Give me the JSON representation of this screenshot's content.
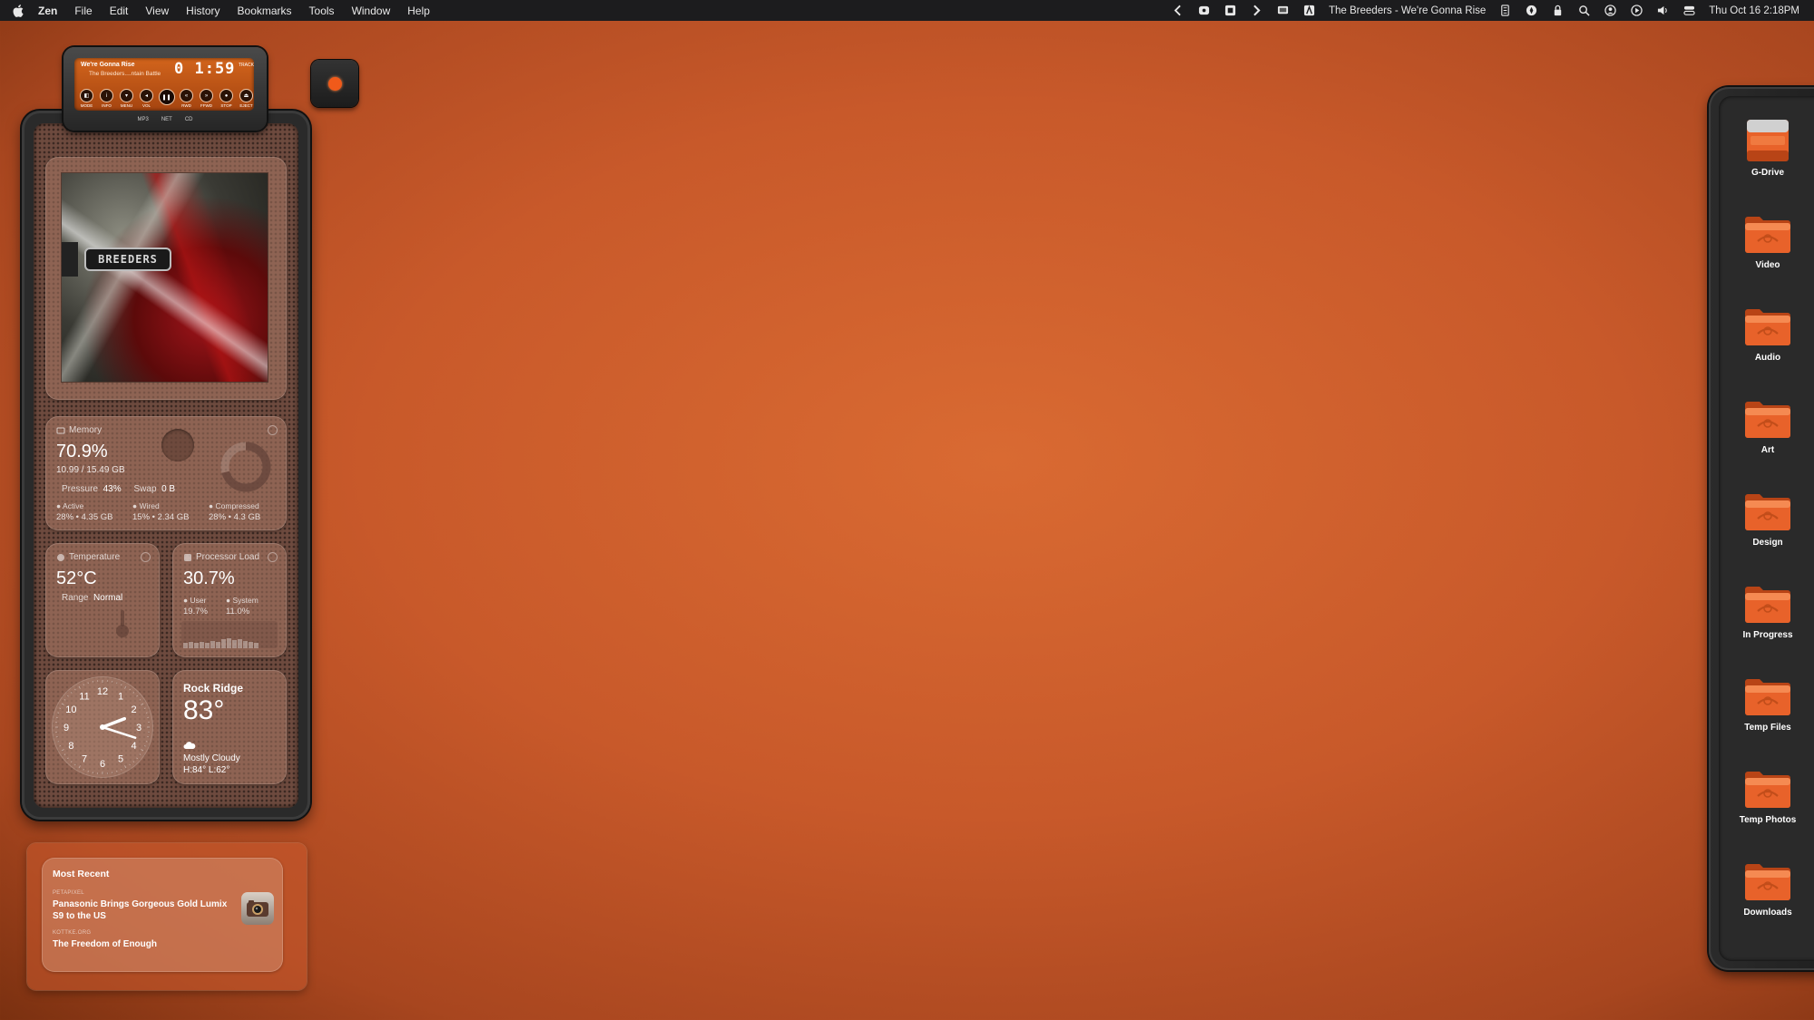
{
  "menubar": {
    "app_name": "Zen",
    "menus": [
      "File",
      "Edit",
      "View",
      "History",
      "Bookmarks",
      "Tools",
      "Window",
      "Help"
    ],
    "now_playing": "The Breeders - We're Gonna Rise",
    "datetime": "Thu Oct 16  2:18PM"
  },
  "player": {
    "track_title": "We're Gonna Rise",
    "track_artist": "The Breeders....ntain Battle",
    "time": "0 1:59",
    "track_label": "TRACK",
    "buttons": [
      "MODE",
      "INFO",
      "MENU",
      "VOL",
      "",
      "RWD",
      "FFWD",
      "STOP",
      "EJECT"
    ],
    "footer": [
      "MP3",
      "NET",
      "CD"
    ]
  },
  "album_art": {
    "band_label": "BREEDERS"
  },
  "memory": {
    "heading": "Memory",
    "percent": "70.9%",
    "used": "10.99 / 15.49 GB",
    "pressure_label": "Pressure",
    "pressure_value": "43%",
    "swap_label": "Swap",
    "swap_value": "0 B",
    "active_label": "Active",
    "active_value": "28% • 4.35 GB",
    "wired_label": "Wired",
    "wired_value": "15% • 2.34 GB",
    "compressed_label": "Compressed",
    "compressed_value": "28% • 4.3 GB",
    "donut_fraction": 0.709
  },
  "temperature": {
    "heading": "Temperature",
    "value": "52°C",
    "range_label": "Range",
    "range_value": "Normal"
  },
  "processor": {
    "heading": "Processor Load",
    "value": "30.7%",
    "user_label": "User",
    "user_value": "19.7%",
    "system_label": "System",
    "system_value": "11.0%"
  },
  "clock": {
    "numbers": [
      "12",
      "1",
      "2",
      "3",
      "4",
      "5",
      "6",
      "7",
      "8",
      "9",
      "10",
      "11"
    ],
    "hour": 2,
    "minute": 18
  },
  "weather": {
    "city": "Rock Ridge",
    "temperature": "83°",
    "condition": "Mostly Cloudy",
    "high_low": "H:84° L:62°"
  },
  "news": {
    "heading": "Most Recent",
    "items": [
      {
        "source": "PETAPIXEL",
        "headline": "Panasonic Brings Gorgeous Gold Lumix S9 to the US"
      },
      {
        "source": "KOTTKE.ORG",
        "headline": "The Freedom of Enough"
      }
    ]
  },
  "dock": {
    "items": [
      {
        "label": "G-Drive",
        "icon": "drive-icon"
      },
      {
        "label": "Video",
        "icon": "folder-icon"
      },
      {
        "label": "Audio",
        "icon": "folder-icon"
      },
      {
        "label": "Art",
        "icon": "folder-icon"
      },
      {
        "label": "Design",
        "icon": "folder-icon"
      },
      {
        "label": "In Progress",
        "icon": "folder-icon"
      },
      {
        "label": "Temp Files",
        "icon": "folder-icon"
      },
      {
        "label": "Temp Photos",
        "icon": "folder-icon"
      },
      {
        "label": "Downloads",
        "icon": "folder-icon"
      }
    ]
  },
  "colors": {
    "desktop": "#c8592a",
    "accent": "#f05a1a",
    "folder": "#e8622a"
  }
}
